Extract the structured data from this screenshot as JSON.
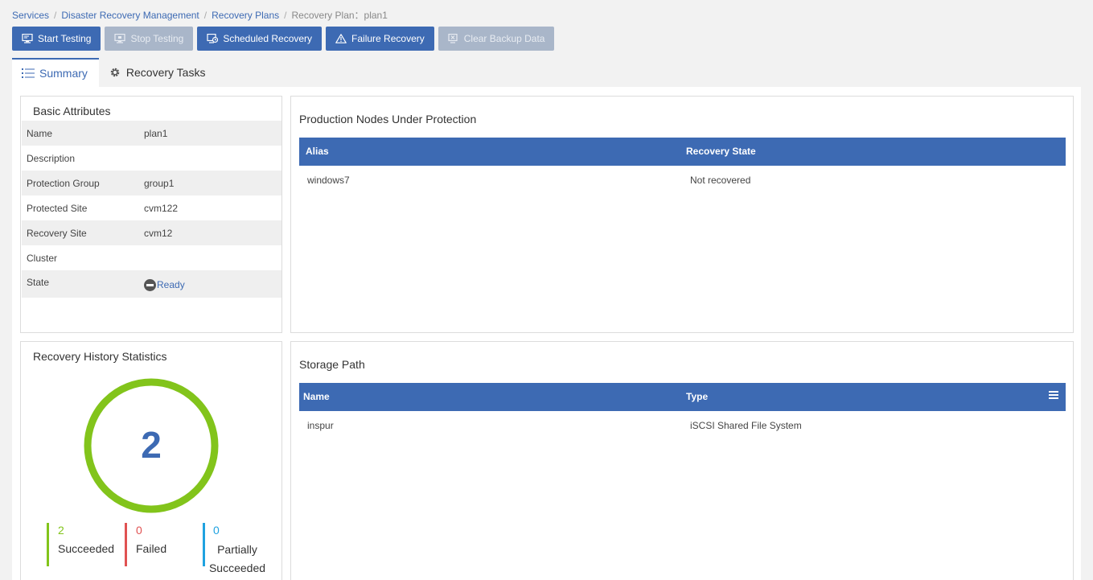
{
  "breadcrumb": {
    "items": [
      "Services",
      "Disaster Recovery Management",
      "Recovery Plans"
    ],
    "current": "Recovery Plan：plan1"
  },
  "toolbar": {
    "start_testing": "Start Testing",
    "stop_testing": "Stop Testing",
    "scheduled_recovery": "Scheduled Recovery",
    "failure_recovery": "Failure Recovery",
    "clear_backup_data": "Clear Backup Data"
  },
  "tabs": {
    "summary": "Summary",
    "recovery_tasks": "Recovery Tasks"
  },
  "basic_attributes": {
    "title": "Basic Attributes",
    "rows": [
      {
        "label": "Name",
        "value": "plan1"
      },
      {
        "label": "Description",
        "value": ""
      },
      {
        "label": "Protection Group",
        "value": "group1"
      },
      {
        "label": "Protected Site",
        "value": "cvm122"
      },
      {
        "label": "Recovery Site",
        "value": "cvm12"
      },
      {
        "label": "Cluster",
        "value": ""
      },
      {
        "label": "State",
        "value": "Ready"
      }
    ]
  },
  "production_nodes": {
    "title": "Production Nodes Under Protection",
    "columns": [
      "Alias",
      "Recovery State"
    ],
    "rows": [
      [
        "windows7",
        "Not recovered"
      ]
    ]
  },
  "history_stats": {
    "title": "Recovery History Statistics",
    "total": "2",
    "succeeded": {
      "count": "2",
      "label": "Succeeded",
      "color": "#82c41b"
    },
    "failed": {
      "count": "0",
      "label": "Failed",
      "color": "#e05252"
    },
    "partial": {
      "count": "0",
      "label": "Partially Succeeded",
      "color": "#1fa2e0"
    }
  },
  "storage_path": {
    "title": "Storage Path",
    "columns": [
      "Name",
      "Type"
    ],
    "rows": [
      [
        "inspur",
        "iSCSI Shared File System"
      ]
    ]
  },
  "colors": {
    "accent": "#3d6ab3",
    "ring": "#82c41b",
    "disabled_button": "#a9b6c9"
  },
  "icons": {
    "start_testing": "monitor-test-icon",
    "stop_testing": "monitor-stop-icon",
    "scheduled_recovery": "scheduled-recovery-icon",
    "failure_recovery": "warning-triangle-icon",
    "clear_backup_data": "clear-data-icon",
    "summary_tab": "list-icon",
    "recovery_tasks_tab": "gear-icon",
    "state": "minus-circle-icon",
    "grid_menu": "hamburger-menu-icon"
  }
}
